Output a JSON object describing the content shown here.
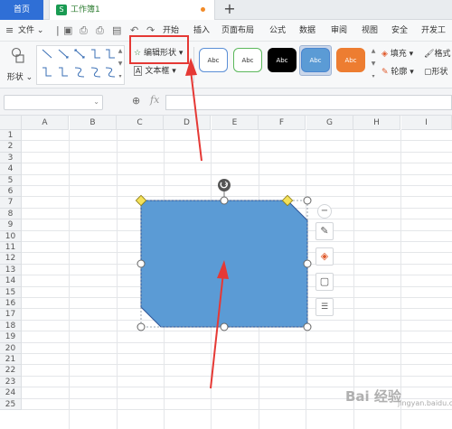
{
  "tabs": {
    "home": "首页",
    "doc_icon": "S",
    "doc_title": "工作簿1"
  },
  "menubar": {
    "file": "文件",
    "items": [
      "开始",
      "插入",
      "页面布局",
      "公式",
      "数据",
      "审阅",
      "视图",
      "安全",
      "开发工具"
    ]
  },
  "ribbon": {
    "shape_label": "形状",
    "edit_shape": "编辑形状",
    "text_box": "文本框",
    "styles": [
      {
        "label": "Abc",
        "border": "#5b8fd6",
        "bg": "#ffffff",
        "text": "#333333"
      },
      {
        "label": "Abc",
        "border": "#5cb85c",
        "bg": "#ffffff",
        "text": "#333333"
      },
      {
        "label": "Abc",
        "border": "#000000",
        "bg": "#000000",
        "text": "#ffffff"
      },
      {
        "label": "Abc",
        "border": "#4a86d0",
        "bg": "#5b9bd5",
        "text": "#ffffff"
      },
      {
        "label": "Abc",
        "border": "#ed7d31",
        "bg": "#ed7d31",
        "text": "#ffffff"
      }
    ],
    "fill": "填充",
    "outline": "轮廓",
    "format_painter": "格式",
    "shape_effects": "形状"
  },
  "formula": {
    "fx": "fx",
    "cell_ref": "",
    "value": ""
  },
  "columns": [
    "A",
    "B",
    "C",
    "D",
    "E",
    "F",
    "G",
    "H",
    "I"
  ],
  "rows": [
    "1",
    "2",
    "3",
    "4",
    "5",
    "6",
    "7",
    "8",
    "9",
    "10",
    "11",
    "12",
    "13",
    "14",
    "15",
    "16",
    "17",
    "18",
    "19",
    "20",
    "21",
    "22",
    "23",
    "24",
    "25"
  ],
  "shape": {
    "fill": "#5b9bd5",
    "stroke": "#2f5597"
  },
  "annotation_color": "#e53935",
  "watermark": {
    "logo": "Bai 经验",
    "sub": "jingyan.baidu.com"
  }
}
